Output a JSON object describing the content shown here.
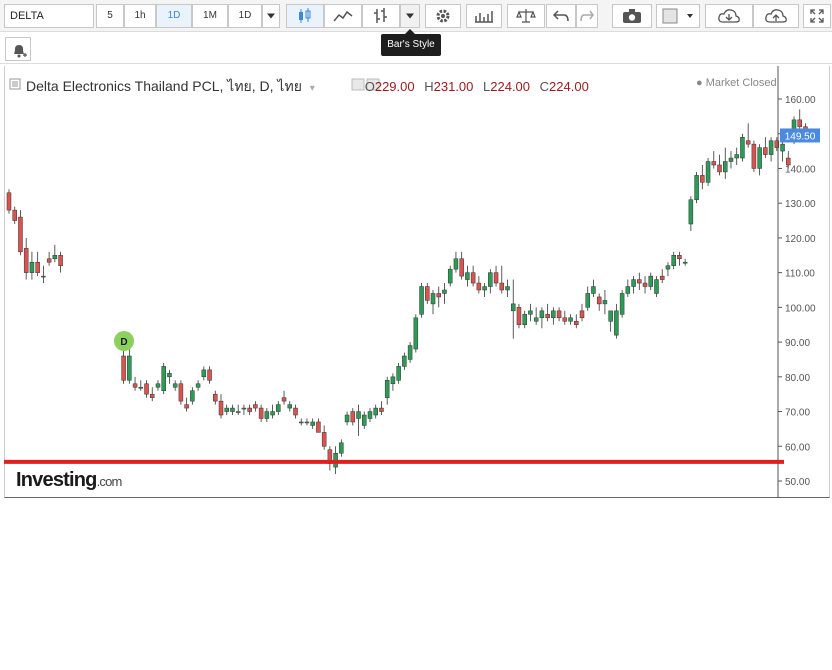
{
  "toolbar": {
    "symbol": "DELTA",
    "intervals": [
      "5",
      "1h",
      "1D",
      "1M",
      "1D"
    ],
    "active_interval": "1D",
    "tooltip": "Bar's Style",
    "icons": [
      "candles-icon",
      "line-chart-icon",
      "bars-icon",
      "dropdown-icon",
      "gear-icon",
      "indicators-icon",
      "balance-icon",
      "undo-icon",
      "redo-icon",
      "camera-icon",
      "color-box-icon",
      "cloud-download-icon",
      "cloud-upload-icon",
      "fullscreen-icon"
    ]
  },
  "legend": {
    "title": "Delta Electronics Thailand PCL, ไทย, D, ไทย",
    "o_label": "O",
    "o": "229.00",
    "h_label": "H",
    "h": "231.00",
    "l_label": "L",
    "l": "224.00",
    "c_label": "C",
    "c": "224.00",
    "status": "Market Closed"
  },
  "watermark": {
    "brand": "Investing",
    "suffix": ".com"
  },
  "marker": "D",
  "colors": {
    "up": "#2b9b55",
    "down": "#d9534f",
    "support": "#e02020",
    "price_tag": "#4a8be0"
  },
  "chart_data": {
    "type": "candlestick",
    "ylim": [
      45,
      165
    ],
    "y_ticks": [
      "160.00",
      "150.00",
      "140.00",
      "130.00",
      "120.00",
      "110.00",
      "100.00",
      "90.00",
      "80.00",
      "70.00",
      "60.00",
      "50.00"
    ],
    "last_price": "149.50",
    "support_level": 55.5,
    "candles": [
      [
        133,
        134,
        127,
        128
      ],
      [
        128,
        129,
        124,
        125
      ],
      [
        126,
        128,
        115,
        116
      ],
      [
        117,
        120,
        108,
        110
      ],
      [
        110,
        116,
        108,
        113
      ],
      [
        113,
        116,
        109,
        110
      ],
      [
        109,
        112,
        107,
        109
      ],
      [
        114,
        116,
        112,
        113
      ],
      [
        114,
        118,
        113,
        115
      ],
      [
        115,
        116,
        110,
        112
      ],
      [
        null,
        null,
        null,
        null
      ],
      [
        null,
        null,
        null,
        null
      ],
      [
        null,
        null,
        null,
        null
      ],
      [
        null,
        null,
        null,
        null
      ],
      [
        null,
        null,
        null,
        null
      ],
      [
        null,
        null,
        null,
        null
      ],
      [
        null,
        null,
        null,
        null
      ],
      [
        null,
        null,
        null,
        null
      ],
      [
        null,
        null,
        null,
        null
      ],
      [
        null,
        null,
        null,
        null
      ],
      [
        86,
        88,
        78,
        79
      ],
      [
        79,
        88,
        78,
        86
      ],
      [
        78,
        80,
        76,
        77
      ],
      [
        77,
        79,
        76,
        77
      ],
      [
        78,
        79,
        74,
        75
      ],
      [
        75,
        77,
        73,
        74
      ],
      [
        77,
        79,
        76,
        78
      ],
      [
        76,
        84,
        75,
        83
      ],
      [
        80,
        82,
        78,
        81
      ],
      [
        77,
        79,
        76,
        78
      ],
      [
        78,
        79,
        72,
        73
      ],
      [
        72,
        74,
        70,
        71
      ],
      [
        73,
        77,
        72,
        76
      ],
      [
        77,
        79,
        76,
        78
      ],
      [
        80,
        83,
        79,
        82
      ],
      [
        82,
        83,
        78,
        79
      ],
      [
        75,
        76,
        72,
        73
      ],
      [
        73,
        75,
        68,
        69
      ],
      [
        70,
        72,
        69,
        71
      ],
      [
        70,
        72,
        69,
        71
      ],
      [
        70,
        72,
        69,
        70
      ],
      [
        71,
        72,
        69,
        71
      ],
      [
        71,
        72,
        69,
        70
      ],
      [
        72,
        73,
        70,
        71
      ],
      [
        71,
        72,
        67,
        68
      ],
      [
        68,
        71,
        67,
        70
      ],
      [
        69,
        72,
        68,
        70
      ],
      [
        70,
        73,
        69,
        72
      ],
      [
        74,
        76,
        72,
        73
      ],
      [
        71,
        73,
        70,
        72
      ],
      [
        71,
        72,
        68,
        69
      ],
      [
        67,
        68,
        66,
        67
      ],
      [
        67,
        68,
        66,
        67
      ],
      [
        66,
        68,
        65,
        67
      ],
      [
        67,
        68,
        64,
        64
      ],
      [
        64,
        66,
        59,
        60
      ],
      [
        59,
        60,
        53,
        55
      ],
      [
        54,
        60,
        52,
        58
      ],
      [
        58,
        62,
        57,
        61
      ],
      [
        67,
        70,
        66,
        69
      ],
      [
        70,
        71,
        66,
        67
      ],
      [
        68,
        72,
        63,
        70
      ],
      [
        66,
        70,
        65,
        69
      ],
      [
        68,
        71,
        67,
        70
      ],
      [
        69,
        72,
        68,
        71
      ],
      [
        71,
        73,
        69,
        70
      ],
      [
        74,
        80,
        72,
        79
      ],
      [
        78,
        81,
        76,
        80
      ],
      [
        79,
        84,
        78,
        83
      ],
      [
        83,
        87,
        82,
        86
      ],
      [
        85,
        90,
        84,
        89
      ],
      [
        88,
        98,
        87,
        97
      ],
      [
        98,
        107,
        97,
        106
      ],
      [
        106,
        107,
        101,
        102
      ],
      [
        101,
        105,
        98,
        104
      ],
      [
        104,
        106,
        100,
        103
      ],
      [
        104,
        107,
        101,
        105
      ],
      [
        107,
        112,
        106,
        111
      ],
      [
        111,
        116,
        110,
        114
      ],
      [
        114,
        116,
        108,
        109
      ],
      [
        108,
        112,
        106,
        110
      ],
      [
        110,
        112,
        106,
        107
      ],
      [
        107,
        109,
        104,
        105
      ],
      [
        105,
        107,
        103,
        106
      ],
      [
        106,
        111,
        104,
        110
      ],
      [
        110,
        112,
        106,
        107
      ],
      [
        107,
        112,
        104,
        105
      ],
      [
        105,
        108,
        103,
        106
      ],
      [
        99,
        108,
        91,
        101
      ],
      [
        100,
        101,
        94,
        95
      ],
      [
        95,
        99,
        94,
        98
      ],
      [
        98,
        101,
        96,
        99
      ],
      [
        96,
        100,
        95,
        97
      ],
      [
        97,
        100,
        94,
        99
      ],
      [
        98,
        101,
        96,
        97
      ],
      [
        97,
        100,
        95,
        99
      ],
      [
        99,
        100,
        96,
        97
      ],
      [
        97,
        99,
        95,
        96
      ],
      [
        96,
        98,
        95,
        97
      ],
      [
        96,
        98,
        94,
        95
      ],
      [
        99,
        101,
        96,
        97
      ],
      [
        100,
        106,
        99,
        104
      ],
      [
        104,
        108,
        103,
        106
      ],
      [
        103,
        104,
        99,
        101
      ],
      [
        101,
        105,
        98,
        102
      ],
      [
        96,
        98,
        93,
        99
      ],
      [
        92,
        101,
        91,
        99
      ],
      [
        98,
        105,
        97,
        104
      ],
      [
        104,
        108,
        103,
        106
      ],
      [
        106,
        109,
        104,
        108
      ],
      [
        108,
        110,
        105,
        107
      ],
      [
        107,
        109,
        104,
        106
      ],
      [
        106,
        110,
        105,
        109
      ],
      [
        104,
        109,
        103,
        108
      ],
      [
        109,
        111,
        107,
        108
      ],
      [
        111,
        113,
        109,
        112
      ],
      [
        112,
        116,
        111,
        115
      ],
      [
        115,
        116,
        112,
        114
      ],
      [
        113,
        114,
        112,
        113
      ],
      [
        124,
        132,
        122,
        131
      ],
      [
        131,
        139,
        130,
        138
      ],
      [
        138,
        141,
        134,
        136
      ],
      [
        136,
        143,
        135,
        142
      ],
      [
        142,
        145,
        140,
        141
      ],
      [
        141,
        144,
        138,
        139
      ],
      [
        139,
        146,
        137,
        142
      ],
      [
        142,
        145,
        140,
        143
      ],
      [
        143,
        146,
        141,
        144
      ],
      [
        143,
        150,
        142,
        149
      ],
      [
        148,
        153,
        146,
        147
      ],
      [
        147,
        148,
        139,
        140
      ],
      [
        140,
        147,
        138,
        146
      ],
      [
        146,
        149,
        143,
        144
      ],
      [
        144,
        149,
        142,
        148
      ],
      [
        148,
        149,
        145,
        146
      ],
      [
        145,
        148,
        142,
        147
      ],
      [
        143,
        145,
        140,
        141
      ],
      [
        148,
        155,
        147,
        154
      ],
      [
        154,
        157,
        151,
        152
      ],
      [
        152,
        153,
        149,
        150
      ]
    ]
  }
}
